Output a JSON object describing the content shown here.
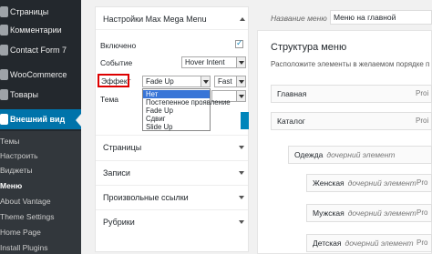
{
  "sidebar": {
    "items": [
      {
        "label": "Страницы"
      },
      {
        "label": "Комментарии"
      },
      {
        "label": "Contact Form 7"
      },
      {
        "label": "WooCommerce"
      },
      {
        "label": "Товары"
      },
      {
        "label": "Внешний вид"
      }
    ],
    "subitems": [
      {
        "label": "Темы"
      },
      {
        "label": "Настроить"
      },
      {
        "label": "Виджеты"
      },
      {
        "label": "Меню"
      },
      {
        "label": "About Vantage"
      },
      {
        "label": "Theme Settings"
      },
      {
        "label": "Home Page"
      },
      {
        "label": "Install Plugins"
      }
    ]
  },
  "mega_menu": {
    "title": "Настройки Max Mega Menu",
    "enabled_label": "Включено",
    "event_label": "Событие",
    "event_value": "Hover Intent",
    "effect_label": "Эффект",
    "effect_value": "Fade Up",
    "speed_value": "Fast",
    "theme_label": "Тема",
    "effect_options": [
      "Нет",
      "Постепенное проявление",
      "Fade Up",
      "Сдвиг",
      "Slide Up"
    ],
    "selected_option": "Нет"
  },
  "sections": [
    {
      "title": "Страницы"
    },
    {
      "title": "Записи"
    },
    {
      "title": "Произвольные ссылки"
    },
    {
      "title": "Рубрики"
    }
  ],
  "menu_name": {
    "label": "Название меню",
    "value": "Меню на главной"
  },
  "structure": {
    "title": "Структура меню",
    "subtitle": "Расположите элементы в желаемом порядке п",
    "items": [
      {
        "title": "Главная",
        "sub": "",
        "right": "Proi"
      },
      {
        "title": "Каталог",
        "sub": "",
        "right": "Proi"
      },
      {
        "title": "Одежда",
        "sub": "дочерний элемент",
        "right": ""
      },
      {
        "title": "Женская",
        "sub": "дочерний элемент",
        "right": "Pro"
      },
      {
        "title": "Мужская",
        "sub": "дочерний элемент",
        "right": "Pro"
      },
      {
        "title": "Детская",
        "sub": "дочерний элемент",
        "right": "Pro"
      }
    ]
  }
}
